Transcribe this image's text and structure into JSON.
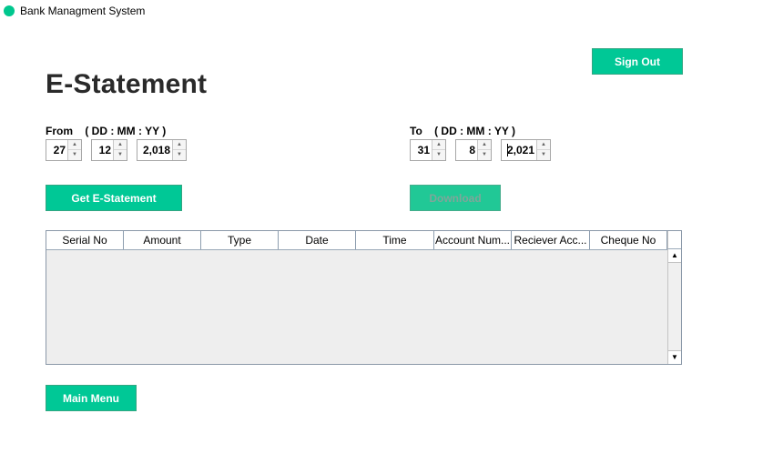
{
  "window": {
    "title": "Bank Managment System"
  },
  "header": {
    "sign_out_label": "Sign Out",
    "page_title": "E-Statement"
  },
  "from": {
    "label": "From    ( DD : MM : YY )",
    "day": "27",
    "month": "12",
    "year": "2,018"
  },
  "to": {
    "label": "To    ( DD : MM : YY )",
    "day": "31",
    "month": "8",
    "year": "2,021"
  },
  "actions": {
    "get_statement_label": "Get E-Statement",
    "download_label": "Download",
    "main_menu_label": "Main Menu"
  },
  "table": {
    "columns": [
      "Serial No",
      "Amount",
      "Type",
      "Date",
      "Time",
      "Account Num...",
      "Reciever Acc...",
      "Cheque No"
    ],
    "rows": []
  },
  "icons": {
    "spinner_up": "triangle-up-icon",
    "spinner_down": "triangle-down-icon",
    "scroll_up": "scroll-up-arrow-icon",
    "scroll_down": "scroll-down-arrow-icon",
    "app": "app-dot-icon"
  },
  "colors": {
    "accent": "#00c896",
    "accent_disabled": "#21c896",
    "title_text": "#2a2a2a",
    "table_bg": "#eeeeee"
  }
}
